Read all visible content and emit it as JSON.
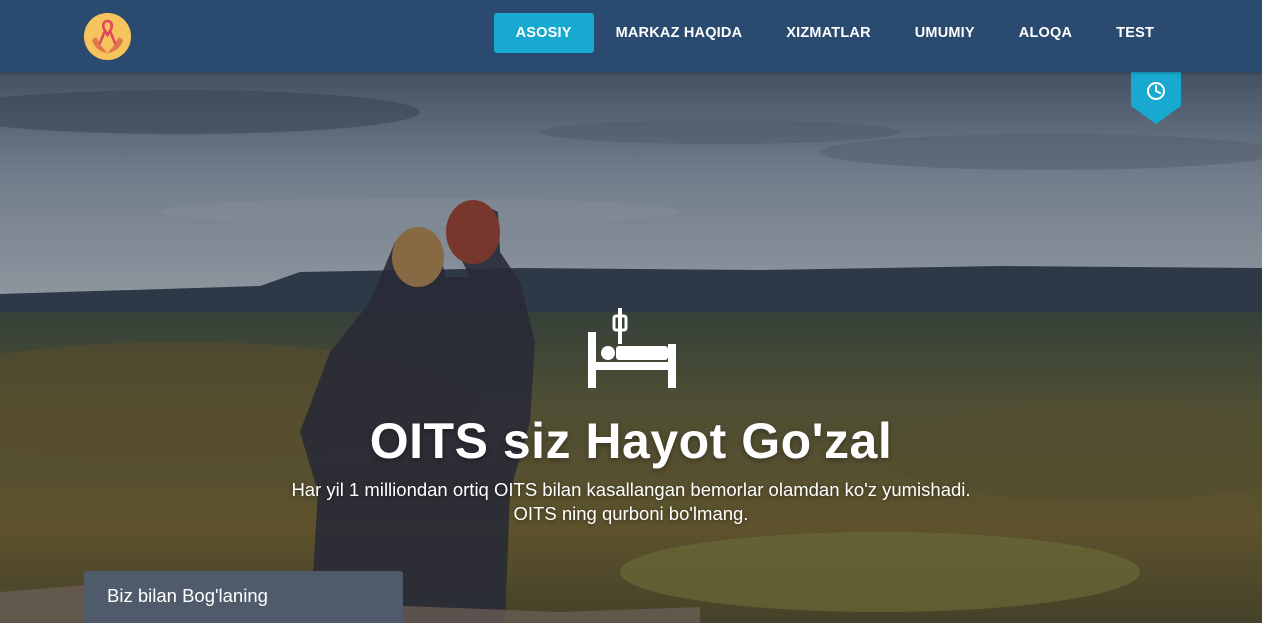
{
  "header": {
    "logo_icon": "ribbon-hands-logo",
    "nav": [
      {
        "label": "ASOSIY",
        "active": true
      },
      {
        "label": "MARKAZ HAQIDA",
        "active": false
      },
      {
        "label": "XIZMATLAR",
        "active": false
      },
      {
        "label": "UMUMIY",
        "active": false
      },
      {
        "label": "ALOQA",
        "active": false
      },
      {
        "label": "TEST",
        "active": false
      }
    ]
  },
  "hero": {
    "ribbon_icon": "clock-icon",
    "bed_icon": "hospital-bed-icon",
    "title": "OITS siz Hayot Go'zal",
    "subtitle_line1": "Har yil 1 milliondan ortiq OITS bilan kasallangan bemorlar olamdan ko'z yumishadi.",
    "subtitle_line2": "OITS ning qurboni bo'lmang.",
    "contact_button": "Biz bilan Bog'laning"
  },
  "colors": {
    "header_bg": "#2b4a6f",
    "active_nav": "#17a9cf",
    "ribbon": "#17a9cf",
    "contact_bg": "#4f5a6a"
  }
}
